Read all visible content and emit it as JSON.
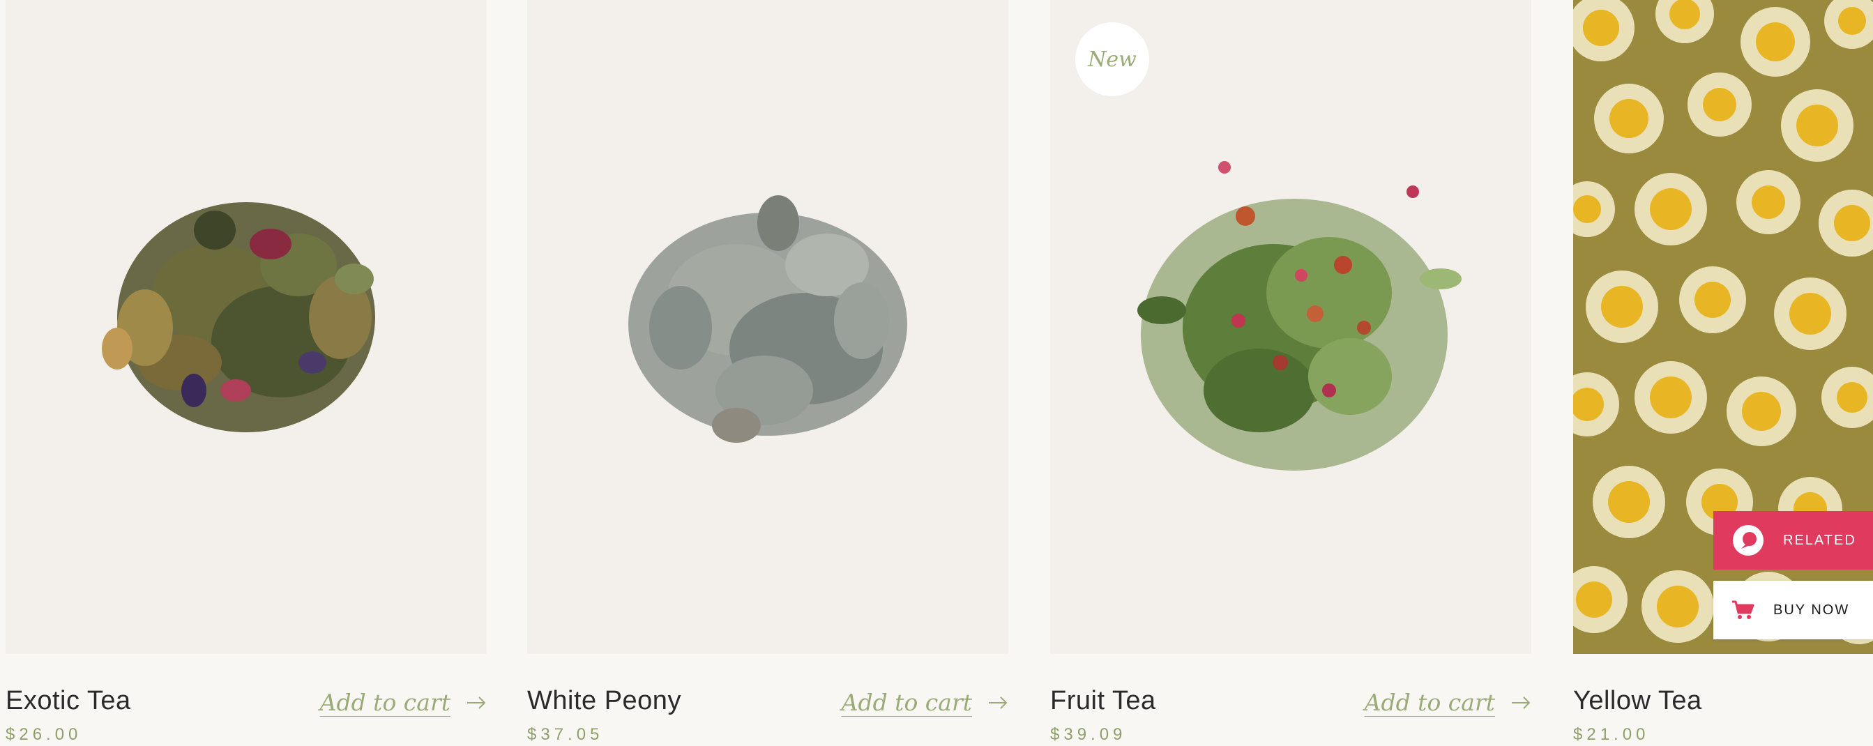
{
  "products": [
    {
      "name": "Exotic Tea",
      "price": "$26.00",
      "add_to_cart": "Add to cart",
      "badge": ""
    },
    {
      "name": "White Peony",
      "price": "$37.05",
      "add_to_cart": "Add to cart",
      "badge": ""
    },
    {
      "name": "Fruit Tea",
      "price": "$39.09",
      "add_to_cart": "Add to cart",
      "badge": "New"
    },
    {
      "name": "Yellow Tea",
      "price": "$21.00",
      "add_to_cart": "",
      "badge": ""
    }
  ],
  "floating_actions": {
    "related_label": "RELATED",
    "buy_now_label": "BUY NOW"
  },
  "colors": {
    "background": "#f9f7f4",
    "card_background": "#f3efea",
    "accent_green": "#9aab77",
    "price_green": "#8ea06a",
    "related_red": "#e03a5e"
  },
  "icons": {
    "arrow": "arrow-right-icon",
    "related": "related-logo-icon",
    "cart": "shopping-cart-icon"
  }
}
